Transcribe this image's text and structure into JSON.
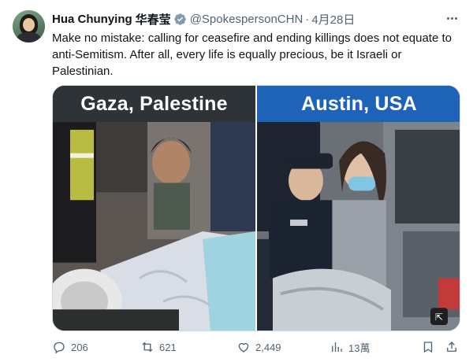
{
  "author": {
    "name": "Hua Chunying",
    "name_cn": "华春莹",
    "handle": "@SpokespersonCHN",
    "separator": "·",
    "date": "4月28日",
    "verified": true,
    "badge_color": "#829aab"
  },
  "tweet": {
    "text": "Make no mistake: calling for ceasefire and ending killings does not equate to anti-Semitism. After all, every life is equally precious, be it Israeli or Palestinian."
  },
  "media": {
    "left_caption": "Gaza, Palestine",
    "right_caption": "Austin, USA",
    "left_banner_color": "#2e3338",
    "right_banner_color": "#1e63b8"
  },
  "stats": {
    "replies": "206",
    "reposts": "621",
    "likes": "2,449",
    "views": "13萬"
  },
  "colors": {
    "text_primary": "#0f1419",
    "text_secondary": "#536471"
  }
}
